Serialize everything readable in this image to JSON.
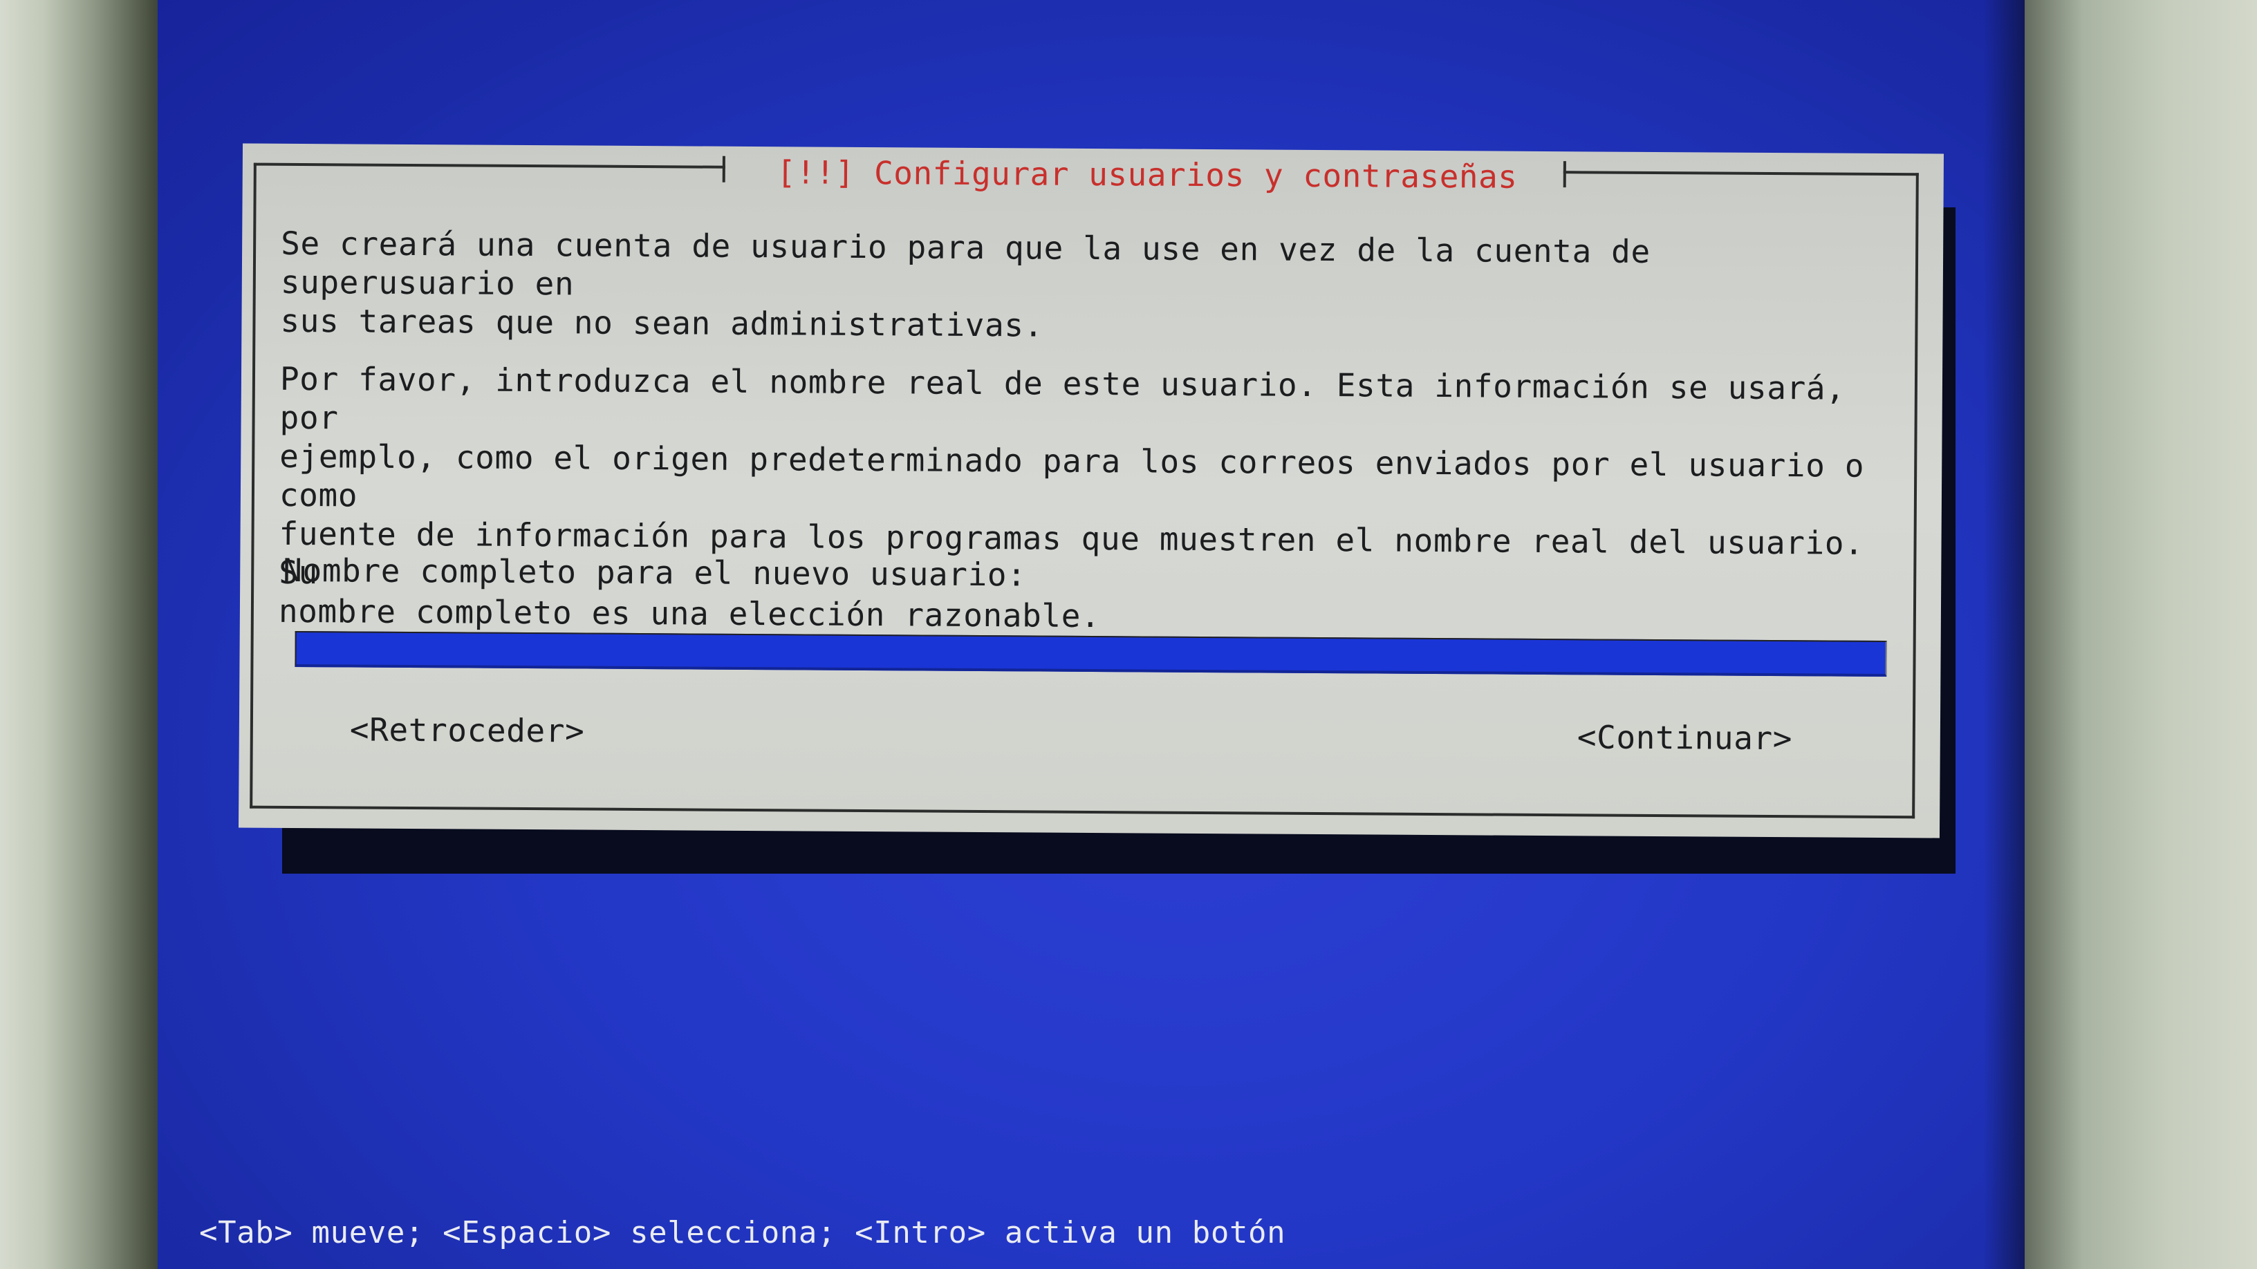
{
  "dialog": {
    "title": "[!!] Configurar usuarios y contraseñas",
    "paragraph1": "Se creará una cuenta de usuario para que la use en vez de la cuenta de superusuario en\nsus tareas que no sean administrativas.",
    "paragraph2": "Por favor, introduzca el nombre real de este usuario. Esta información se usará, por\nejemplo, como el origen predeterminado para los correos enviados por el usuario o como\nfuente de información para los programas que muestren el nombre real del usuario. Su\nnombre completo es una elección razonable.",
    "prompt": "Nombre completo para el nuevo usuario:",
    "input_value": "",
    "back_button": "<Retroceder>",
    "continue_button": "<Continuar>"
  },
  "statusbar": {
    "help": "<Tab> mueve; <Espacio> selecciona; <Intro> activa un botón"
  },
  "colors": {
    "screen_background": "#2337c6",
    "dialog_background": "#d6d8d4",
    "title_text": "#c8302c",
    "input_field": "#1a35d6",
    "status_text": "#e9ebf2"
  }
}
